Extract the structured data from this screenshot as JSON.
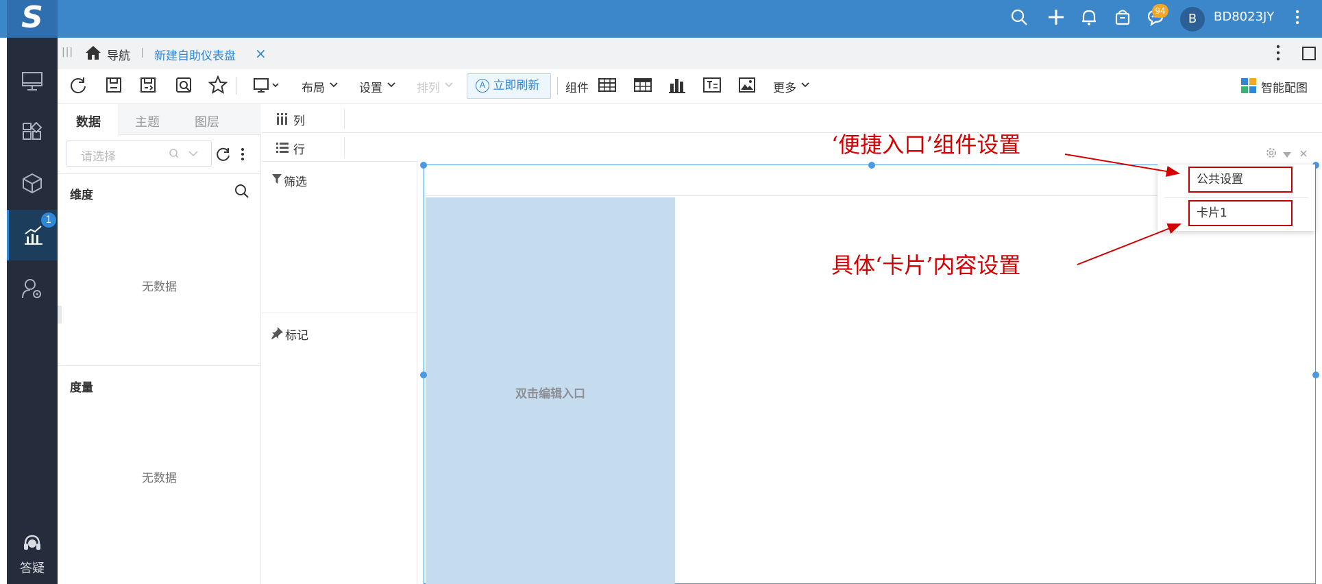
{
  "topbar": {
    "logo": "S",
    "notification_count": "94",
    "avatar_initial": "B",
    "username": "BD8023JY"
  },
  "sidebar": {
    "active_badge": "1",
    "help_label": "答疑"
  },
  "tabbar": {
    "home_label": "导航",
    "active_tab": "新建自助仪表盘",
    "close_symbol": "×"
  },
  "toolbar": {
    "layout_label": "布局",
    "settings_label": "设置",
    "arrange_label": "排列",
    "refresh_now_label": "立即刷新",
    "components_label": "组件",
    "more_label": "更多",
    "smart_chart_label": "智能配图"
  },
  "data_panel": {
    "tabs": [
      "数据",
      "主题",
      "图层"
    ],
    "select_placeholder": "请选择",
    "dimension_label": "维度",
    "measure_label": "度量",
    "empty_text": "无数据"
  },
  "shelf": {
    "columns_label": "列",
    "rows_label": "行",
    "filter_label": "筛选",
    "marks_label": "标记"
  },
  "canvas": {
    "card_placeholder": "双击编辑入口"
  },
  "popup_menu": {
    "items": [
      "公共设置",
      "卡片1"
    ]
  },
  "annotations": {
    "top": "‘便捷入口’组件设置",
    "bottom": "具体‘卡片’内容设置"
  },
  "colors": {
    "topbar": "#3b87c9",
    "sidebar": "#252c3b",
    "accent": "#2f87d6",
    "annotation": "#d40000",
    "card": "#c5dcef"
  }
}
